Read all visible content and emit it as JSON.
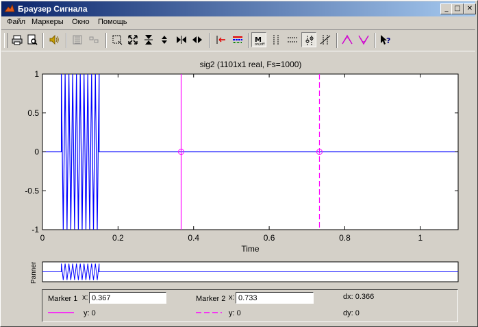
{
  "window": {
    "title": "Браузер Сигнала",
    "minimize_glyph": "_",
    "maximize_glyph": "□",
    "close_glyph": "✕"
  },
  "menu": {
    "items": [
      "Файл",
      "Маркеры",
      "Окно",
      "Помощь"
    ]
  },
  "toolbar": {
    "icons": [
      "print-icon",
      "print-preview-icon",
      "play-sound-icon",
      "array-signals-icon",
      "select-trace-icon",
      "zoom-box-icon",
      "zoom-in-out-icon",
      "vertical-zoom-icon",
      "vertical-center-icon",
      "zoom-in-x-icon",
      "zoom-out-x-icon",
      "select-marker-icon",
      "line-properties-icon",
      "markers-toggle-icon",
      "vertical-markers-icon",
      "horizontal-markers-icon",
      "track-markers-icon",
      "slope-markers-icon",
      "peaks-icon",
      "valleys-icon",
      "help-icon"
    ]
  },
  "chart_data": {
    "type": "line",
    "title": "sig2 (1101x1 real, Fs=1000)",
    "xlabel": "Time",
    "ylabel": "",
    "xlim": [
      0,
      1.1
    ],
    "ylim": [
      -1,
      1
    ],
    "xticks": [
      "0",
      "0.2",
      "0.4",
      "0.6",
      "0.8",
      "1"
    ],
    "yticks": [
      "-1",
      "-0.5",
      "0",
      "0.5",
      "1"
    ],
    "series": [
      {
        "burst_start": 0.05,
        "burst_end": 0.15,
        "burst_amplitude": 1,
        "burst_cycles": 10,
        "baseline": 0,
        "color": "#0000ff"
      }
    ],
    "markers": [
      {
        "x": 0.367,
        "y": 0,
        "style": "solid",
        "color": "#ff00ff"
      },
      {
        "x": 0.733,
        "y": 0,
        "style": "dashed",
        "color": "#ff00ff"
      }
    ]
  },
  "panner": {
    "label": "Panner"
  },
  "marker_panel": {
    "marker1": {
      "label": "Marker 1",
      "x_label": "x:",
      "x_value": "0.367",
      "y_text": "y: 0"
    },
    "marker2": {
      "label": "Marker 2",
      "x_label": "x:",
      "x_value": "0.733",
      "y_text": "y: 0"
    },
    "dx": "dx: 0.366",
    "dy": "dy: 0"
  }
}
